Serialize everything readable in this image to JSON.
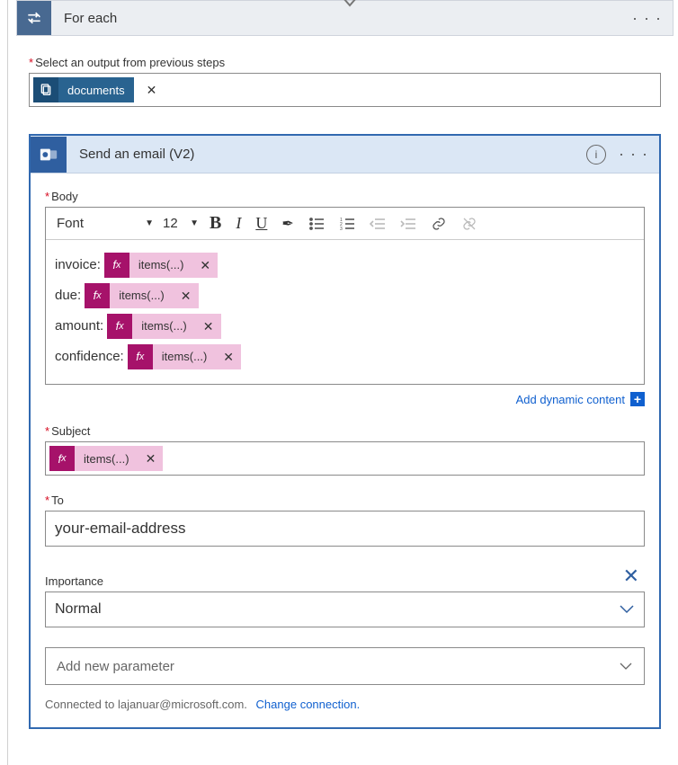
{
  "foreach": {
    "title": "For each",
    "selectOutputLabel": "Select an output from previous steps",
    "documentsToken": "documents"
  },
  "email": {
    "title": "Send an email (V2)",
    "bodyLabel": "Body",
    "toolbar": {
      "font": "Font",
      "size": "12"
    },
    "bodyLines": [
      {
        "prefix": "invoice:",
        "expr": "items(...)"
      },
      {
        "prefix": "due:",
        "expr": "items(...)"
      },
      {
        "prefix": "amount:",
        "expr": "items(...)"
      },
      {
        "prefix": "confidence:",
        "expr": "items(...)"
      }
    ],
    "addDynamic": "Add dynamic content",
    "subjectLabel": "Subject",
    "subjectExpr": "items(...)",
    "toLabel": "To",
    "toValue": "your-email-address",
    "importanceLabel": "Importance",
    "importanceValue": "Normal",
    "addParam": "Add new parameter",
    "connectedTo": "Connected to lajanuar@microsoft.com.",
    "changeConn": "Change connection."
  }
}
